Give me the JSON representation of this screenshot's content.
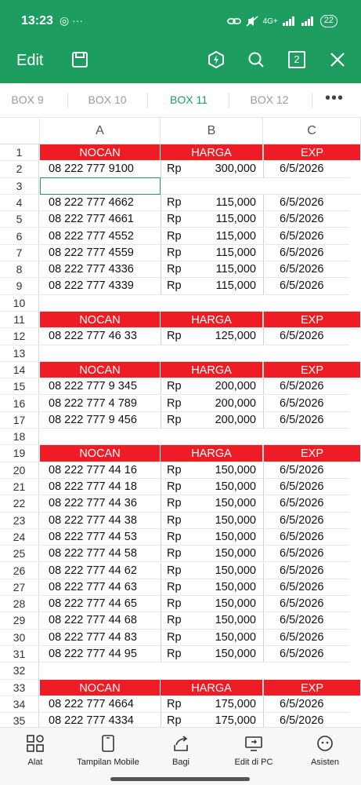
{
  "status": {
    "time": "13:23",
    "left_icons": "◎ ···",
    "net": "4G+",
    "battery": "22"
  },
  "toolbar": {
    "edit_label": "Edit",
    "tabs_count": "2"
  },
  "tabs": [
    {
      "label": "BOX 9",
      "active": false
    },
    {
      "label": "BOX 10",
      "active": false
    },
    {
      "label": "BOX 11",
      "active": true
    },
    {
      "label": "BOX 12",
      "active": false
    }
  ],
  "columns": [
    "A",
    "B",
    "C"
  ],
  "rows": [
    {
      "n": "1",
      "type": "header",
      "a": "NOCAN",
      "b": "HARGA",
      "c": "EXP"
    },
    {
      "n": "2",
      "type": "data",
      "a": "08 222 777 9100",
      "rp": "Rp",
      "b": "300,000",
      "c": "6/5/2026"
    },
    {
      "n": "3",
      "type": "blank",
      "selected": true
    },
    {
      "n": "4",
      "type": "data",
      "a": "08 222 777 4662",
      "rp": "Rp",
      "b": "115,000",
      "c": "6/5/2026"
    },
    {
      "n": "5",
      "type": "data",
      "a": "08 222 777 4661",
      "rp": "Rp",
      "b": "115,000",
      "c": "6/5/2026"
    },
    {
      "n": "6",
      "type": "data",
      "a": "08 222 777 4552",
      "rp": "Rp",
      "b": "115,000",
      "c": "6/5/2026"
    },
    {
      "n": "7",
      "type": "data",
      "a": "08 222 777 4559",
      "rp": "Rp",
      "b": "115,000",
      "c": "6/5/2026"
    },
    {
      "n": "8",
      "type": "data",
      "a": "08 222 777 4336",
      "rp": "Rp",
      "b": "115,000",
      "c": "6/5/2026"
    },
    {
      "n": "9",
      "type": "data",
      "a": "08 222 777 4339",
      "rp": "Rp",
      "b": "115,000",
      "c": "6/5/2026"
    },
    {
      "n": "10",
      "type": "blank"
    },
    {
      "n": "11",
      "type": "header",
      "a": "NOCAN",
      "b": "HARGA",
      "c": "EXP"
    },
    {
      "n": "12",
      "type": "data",
      "a": "08 222 777 46 33",
      "rp": "Rp",
      "b": "125,000",
      "c": "6/5/2026"
    },
    {
      "n": "13",
      "type": "blank"
    },
    {
      "n": "14",
      "type": "header",
      "a": "NOCAN",
      "b": "HARGA",
      "c": "EXP"
    },
    {
      "n": "15",
      "type": "data",
      "a": "08 222 777 9 345",
      "rp": "Rp",
      "b": "200,000",
      "c": "6/5/2026"
    },
    {
      "n": "16",
      "type": "data",
      "a": "08 222 777 4 789",
      "rp": "Rp",
      "b": "200,000",
      "c": "6/5/2026"
    },
    {
      "n": "17",
      "type": "data",
      "a": "08 222 777 9 456",
      "rp": "Rp",
      "b": "200,000",
      "c": "6/5/2026"
    },
    {
      "n": "18",
      "type": "blank"
    },
    {
      "n": "19",
      "type": "header",
      "a": "NOCAN",
      "b": "HARGA",
      "c": "EXP"
    },
    {
      "n": "20",
      "type": "data",
      "a": "08 222 777 44 16",
      "rp": "Rp",
      "b": "150,000",
      "c": "6/5/2026"
    },
    {
      "n": "21",
      "type": "data",
      "a": "08 222 777 44 18",
      "rp": "Rp",
      "b": "150,000",
      "c": "6/5/2026"
    },
    {
      "n": "22",
      "type": "data",
      "a": "08 222 777 44 36",
      "rp": "Rp",
      "b": "150,000",
      "c": "6/5/2026"
    },
    {
      "n": "23",
      "type": "data",
      "a": "08 222 777 44 38",
      "rp": "Rp",
      "b": "150,000",
      "c": "6/5/2026"
    },
    {
      "n": "24",
      "type": "data",
      "a": "08 222 777 44 53",
      "rp": "Rp",
      "b": "150,000",
      "c": "6/5/2026"
    },
    {
      "n": "25",
      "type": "data",
      "a": "08 222 777 44 58",
      "rp": "Rp",
      "b": "150,000",
      "c": "6/5/2026"
    },
    {
      "n": "26",
      "type": "data",
      "a": "08 222 777 44 62",
      "rp": "Rp",
      "b": "150,000",
      "c": "6/5/2026"
    },
    {
      "n": "27",
      "type": "data",
      "a": "08 222 777 44 63",
      "rp": "Rp",
      "b": "150,000",
      "c": "6/5/2026"
    },
    {
      "n": "28",
      "type": "data",
      "a": "08 222 777 44 65",
      "rp": "Rp",
      "b": "150,000",
      "c": "6/5/2026"
    },
    {
      "n": "29",
      "type": "data",
      "a": "08 222 777 44 68",
      "rp": "Rp",
      "b": "150,000",
      "c": "6/5/2026"
    },
    {
      "n": "30",
      "type": "data",
      "a": "08 222 777 44 83",
      "rp": "Rp",
      "b": "150,000",
      "c": "6/5/2026"
    },
    {
      "n": "31",
      "type": "data",
      "a": "08 222 777 44 95",
      "rp": "Rp",
      "b": "150,000",
      "c": "6/5/2026"
    },
    {
      "n": "32",
      "type": "blank"
    },
    {
      "n": "33",
      "type": "header",
      "a": "NOCAN",
      "b": "HARGA",
      "c": "EXP"
    },
    {
      "n": "34",
      "type": "data",
      "a": "08 222 777 4664",
      "rp": "Rp",
      "b": "175,000",
      "c": "6/5/2026"
    },
    {
      "n": "35",
      "type": "data",
      "a": "08 222 777 4334",
      "rp": "Rp",
      "b": "175,000",
      "c": "6/5/2026"
    }
  ],
  "bottom_nav": [
    {
      "label": "Alat",
      "icon": "grid-shapes-icon"
    },
    {
      "label": "Tampilan Mobile",
      "icon": "phone-view-icon"
    },
    {
      "label": "Bagi",
      "icon": "share-icon"
    },
    {
      "label": "Edit di PC",
      "icon": "monitor-icon"
    },
    {
      "label": "Asisten",
      "icon": "assistant-icon"
    }
  ],
  "colors": {
    "brand_green": "#1e9d60",
    "header_red": "#ee1c25"
  }
}
